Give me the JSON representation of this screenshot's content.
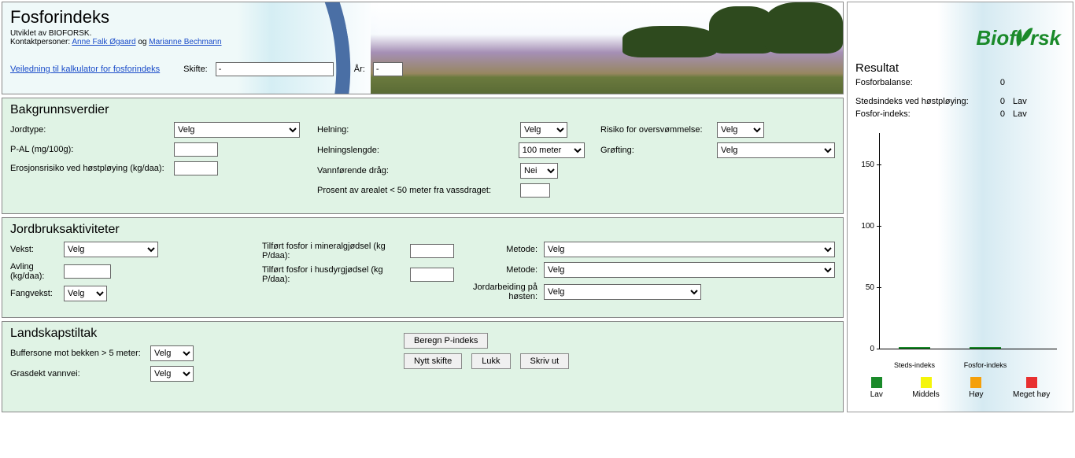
{
  "header": {
    "title": "Fosforindeks",
    "subtitle": "Utviklet av BIOFORSK.",
    "contacts_prefix": "Kontaktpersoner: ",
    "contact1": "Anne Falk Øgaard",
    "contacts_and": " og ",
    "contact2": "Marianne Bechmann",
    "guide_link": "Veiledning til kalkulator for fosforindeks",
    "skifte_label": "Skifte:",
    "skifte_value": "-",
    "ar_label": "År:",
    "ar_value": "-"
  },
  "bg": {
    "title": "Bakgrunnsverdier",
    "jordtype_label": "Jordtype:",
    "jordtype_value": "Velg",
    "pal_label": "P-AL (mg/100g):",
    "pal_value": "",
    "erosjon_label": "Erosjonsrisiko ved høstpløying (kg/daa):",
    "erosjon_value": "",
    "helning_label": "Helning:",
    "helning_value": "Velg",
    "helningslengde_label": "Helningslengde:",
    "helningslengde_value": "100 meter",
    "vannforende_label": "Vannførende dråg:",
    "vannforende_value": "Nei",
    "prosent_label": "Prosent av arealet < 50 meter fra vassdraget:",
    "prosent_value": "",
    "risiko_label": "Risiko for oversvømmelse:",
    "risiko_value": "Velg",
    "grofting_label": "Grøfting:",
    "grofting_value": "Velg"
  },
  "agri": {
    "title": "Jordbruksaktiviteter",
    "vekst_label": "Vekst:",
    "vekst_value": "Velg",
    "avling_label": "Avling (kg/daa):",
    "avling_value": "",
    "fangvekst_label": "Fangvekst:",
    "fangvekst_value": "Velg",
    "mineral_label": "Tilført fosfor i mineralgjødsel (kg P/daa):",
    "mineral_value": "",
    "husdyr_label": "Tilført fosfor i husdyrgjødsel (kg P/daa):",
    "husdyr_value": "",
    "metode1_label": "Metode:",
    "metode1_value": "Velg",
    "metode2_label": "Metode:",
    "metode2_value": "Velg",
    "jordarb_label": "Jordarbeiding på høsten:",
    "jordarb_value": "Velg"
  },
  "land": {
    "title": "Landskapstiltak",
    "buffer_label": "Buffersone mot bekken > 5 meter:",
    "buffer_value": "Velg",
    "gras_label": "Grasdekt vannvei:",
    "gras_value": "Velg"
  },
  "buttons": {
    "beregn": "Beregn P-indeks",
    "nytt": "Nytt skifte",
    "lukk": "Lukk",
    "skriv": "Skriv ut"
  },
  "logo": {
    "part1": "Biof",
    "part2": "rsk"
  },
  "result": {
    "title": "Resultat",
    "fosforbalanse_label": "Fosforbalanse:",
    "fosforbalanse_value": "0",
    "steds_label": "Stedsindeks ved høstpløying:",
    "steds_value": "0",
    "steds_cat": "Lav",
    "fosfor_label": "Fosfor-indeks:",
    "fosfor_value": "0",
    "fosfor_cat": "Lav"
  },
  "chart_data": {
    "type": "bar",
    "categories": [
      "Steds-indeks",
      "Fosfor-indeks"
    ],
    "values": [
      0,
      0
    ],
    "ylim": [
      0,
      160
    ],
    "yticks": [
      0,
      50,
      100,
      150
    ]
  },
  "legend": {
    "lav": "Lav",
    "middels": "Middels",
    "hoy": "Høy",
    "meget": "Meget høy",
    "colors": {
      "lav": "#1a8a2a",
      "middels": "#f5f50a",
      "hoy": "#f5a00a",
      "meget": "#e83030"
    }
  }
}
